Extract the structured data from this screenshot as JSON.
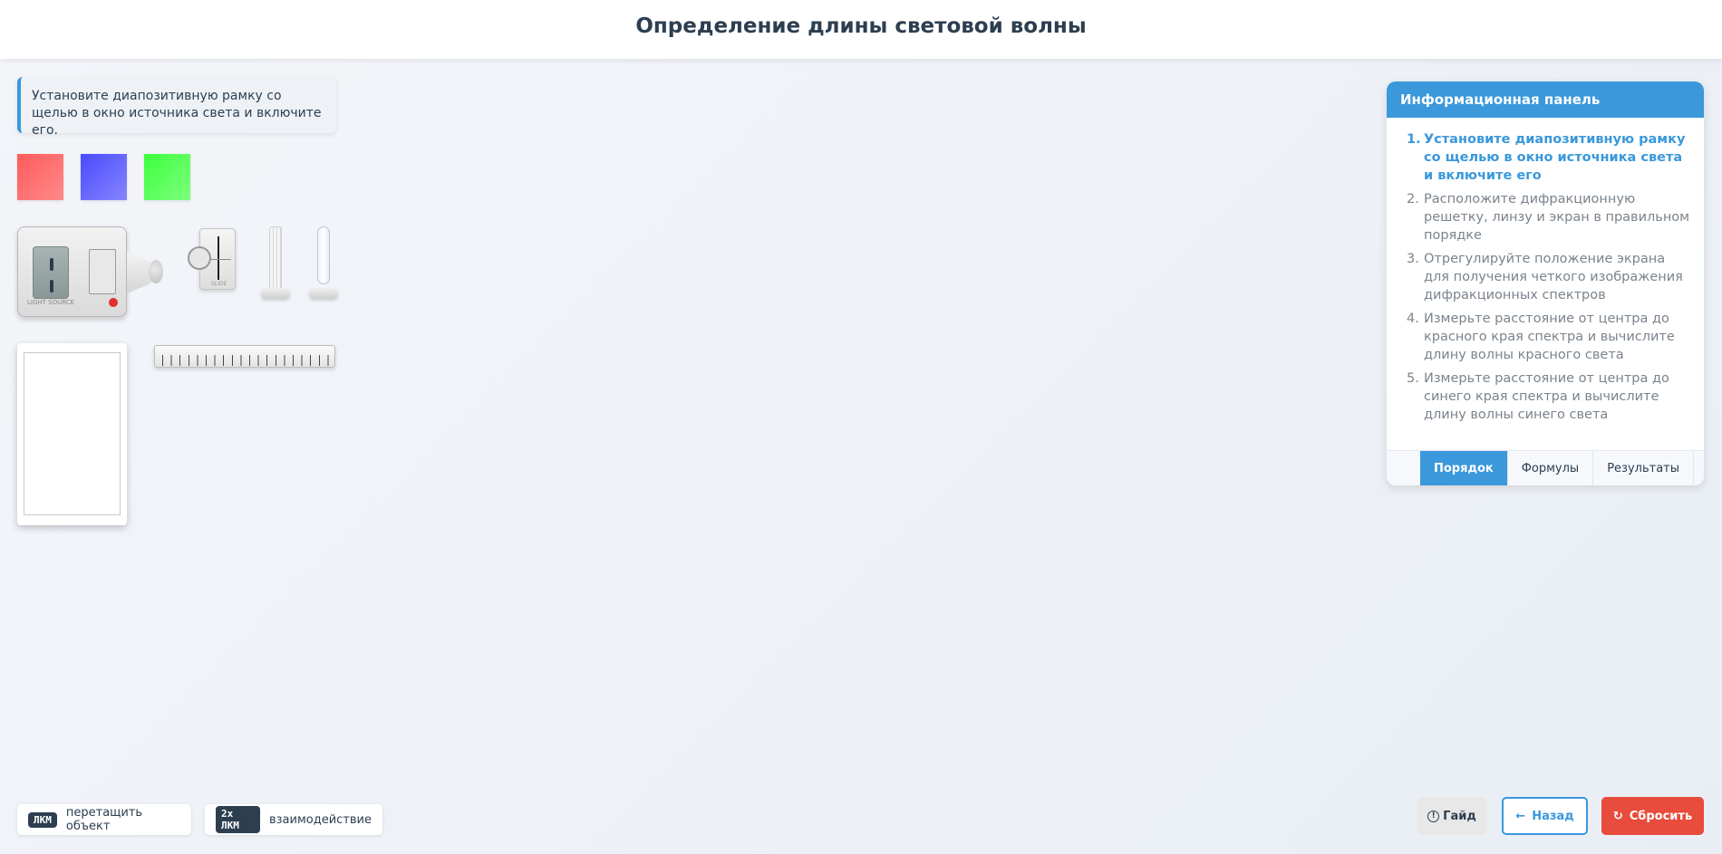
{
  "header": {
    "title": "Определение длины световой волны"
  },
  "instruction": {
    "text": "Установите диапозитивную рамку со щелью в окно источника света и включите его."
  },
  "swatches": [
    {
      "name": "red",
      "color": "#ff6b6b"
    },
    {
      "name": "blue",
      "color": "#6b6bff"
    },
    {
      "name": "green",
      "color": "#6bff6b"
    }
  ],
  "equipment": {
    "light_source_label": "LIGHT SOURCE",
    "slide_label": "SLIDE"
  },
  "panel": {
    "title": "Информационная панель",
    "steps": [
      {
        "num": "1.",
        "text": "Установите диапозитивную рамку со щелью в окно источника света и включите его"
      },
      {
        "num": "2.",
        "text": "Расположите дифракционную решетку, линзу и экран в правильном порядке"
      },
      {
        "num": "3.",
        "text": "Отрегулируйте положение экрана для получения четкого изображения дифракционных спектров"
      },
      {
        "num": "4.",
        "text": "Измерьте расстояние от центра до красного края спектра и вычислите длину волны красного света"
      },
      {
        "num": "5.",
        "text": "Измерьте расстояние от центра до синего края спектра и вычислите длину волны синего света"
      }
    ],
    "tabs": [
      "Порядок",
      "Формулы",
      "Результаты"
    ],
    "active_tab": "Порядок"
  },
  "hints": [
    {
      "key": "ЛКМ",
      "text": "перетащить объект"
    },
    {
      "key": "2x ЛКМ",
      "text": "взаимодействие"
    }
  ],
  "buttons": {
    "guide": "Гайд",
    "back": "Назад",
    "reset": "Сбросить"
  },
  "colors": {
    "accent": "#3a98db",
    "danger": "#e74c3c",
    "text": "#2c3e50"
  }
}
